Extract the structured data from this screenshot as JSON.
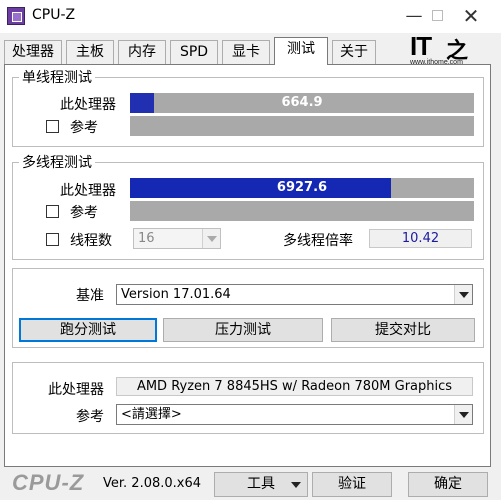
{
  "window": {
    "title": "CPU-Z",
    "minimize_label": "—",
    "close_label": "✕"
  },
  "tabs": [
    {
      "label": "处理器"
    },
    {
      "label": "主板"
    },
    {
      "label": "内存"
    },
    {
      "label": "SPD"
    },
    {
      "label": "显卡"
    },
    {
      "label": "测试",
      "active": true
    },
    {
      "label": "关于"
    }
  ],
  "watermark": {
    "brand_latin": "IT",
    "brand_cn": "之家",
    "url": "www.ithome.com"
  },
  "single_thread": {
    "title": "单线程测试",
    "this_cpu_label": "此处理器",
    "this_cpu_score": "664.9",
    "this_cpu_fill_fraction": 0.07,
    "reference_label": "参考",
    "reference_checked": false
  },
  "multi_thread": {
    "title": "多线程测试",
    "this_cpu_label": "此处理器",
    "this_cpu_score": "6927.6",
    "this_cpu_fill_fraction": 0.76,
    "reference_label": "参考",
    "reference_checked": false,
    "threads_label": "线程数",
    "threads_checked": false,
    "threads_value": "16",
    "ratio_label": "多线程倍率",
    "ratio_value": "10.42"
  },
  "benchmark": {
    "baseline_label": "基准",
    "baseline_value": "Version 17.01.64",
    "run_button": "跑分测试",
    "stress_button": "压力测试",
    "submit_button": "提交对比"
  },
  "compare": {
    "this_cpu_label": "此处理器",
    "this_cpu_name": "AMD Ryzen 7 8845HS w/ Radeon 780M Graphics",
    "reference_label": "参考",
    "reference_value": "<請選擇>"
  },
  "footer": {
    "logo": "CPU-Z",
    "version": "Ver. 2.08.0.x64",
    "tools_button": "工具",
    "validate_button": "验证",
    "ok_button": "确定"
  },
  "colors": {
    "single_bar_fill": "#2030b0",
    "multi_bar_fill": "#1428b4",
    "bar_track": "#a9a9a9",
    "ratio_text": "#1a1aa0",
    "default_button_border": "#0078d7"
  }
}
